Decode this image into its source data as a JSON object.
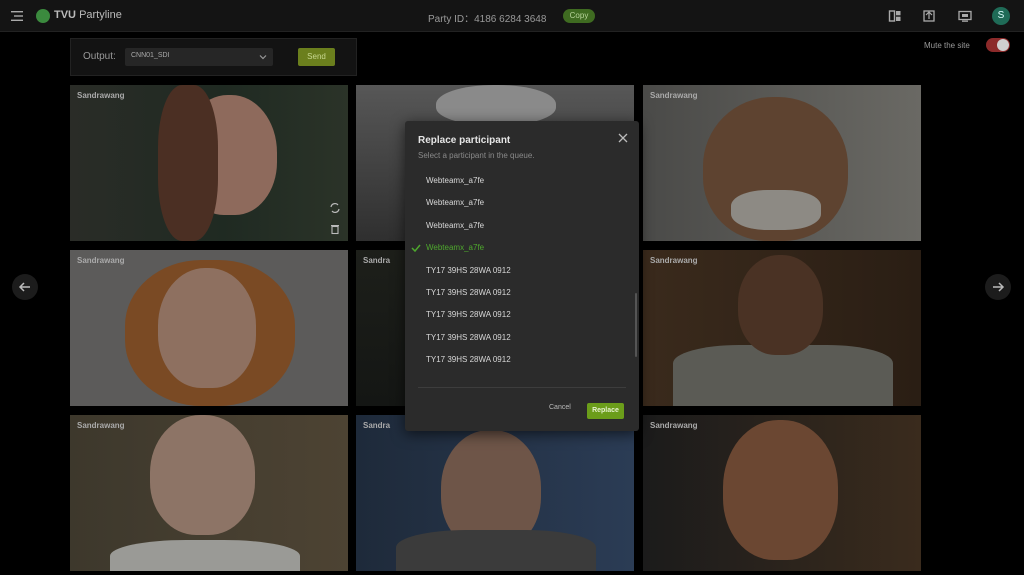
{
  "header": {
    "app_name": "TVU",
    "app_suffix": "Partyline",
    "party_id_label": "Party ID：",
    "party_id": "4186 6284 3648",
    "copy_label": "Copy",
    "avatar_letter": "S"
  },
  "output": {
    "label": "Output:",
    "selected": "CNN01_SDI",
    "send_label": "Send"
  },
  "mute": {
    "label": "Mute the site",
    "on": true
  },
  "tiles": [
    {
      "name": "Sandrawang"
    },
    {
      "name": ""
    },
    {
      "name": "Sandrawang"
    },
    {
      "name": "Sandrawang"
    },
    {
      "name": "Sandra"
    },
    {
      "name": "Sandrawang"
    },
    {
      "name": "Sandrawang"
    },
    {
      "name": "Sandra"
    },
    {
      "name": "Sandrawang"
    }
  ],
  "dialog": {
    "title": "Replace participant",
    "subtitle": "Select a participant in the queue.",
    "items": [
      {
        "label": "Webteamx_a7fe",
        "selected": false
      },
      {
        "label": "Webteamx_a7fe",
        "selected": false
      },
      {
        "label": "Webteamx_a7fe",
        "selected": false
      },
      {
        "label": "Webteamx_a7fe",
        "selected": true
      },
      {
        "label": "TY17 39HS 28WA 0912",
        "selected": false
      },
      {
        "label": "TY17 39HS 28WA 0912",
        "selected": false
      },
      {
        "label": "TY17 39HS 28WA 0912",
        "selected": false
      },
      {
        "label": "TY17 39HS 28WA 0912",
        "selected": false
      },
      {
        "label": "TY17 39HS 28WA 0912",
        "selected": false
      }
    ],
    "cancel_label": "Cancel",
    "replace_label": "Replace"
  },
  "colors": {
    "accent_green": "#4ea82d",
    "toggle_red": "#8c2a2a"
  }
}
